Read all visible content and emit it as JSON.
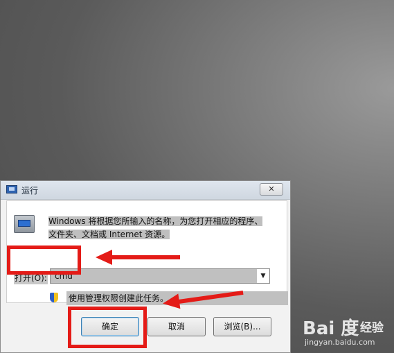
{
  "dialog": {
    "title": "运行",
    "close_label": "✕",
    "description_line1": "Windows 将根据您所输入的名称，为您打开相应的程序、",
    "description_line2": "文件夹、文档或 Internet 资源。",
    "open_label": "打开(O):",
    "open_value": "cmd",
    "combo_arrow": "▼",
    "admin_note": "使用管理权限创建此任务。",
    "buttons": {
      "ok": "确定",
      "cancel": "取消",
      "browse": "浏览(B)..."
    }
  },
  "watermark": {
    "logo": "Bai 度",
    "brand_cn": "经验",
    "url": "jingyan.baidu.com"
  },
  "colors": {
    "annotation": "#e41b17"
  }
}
